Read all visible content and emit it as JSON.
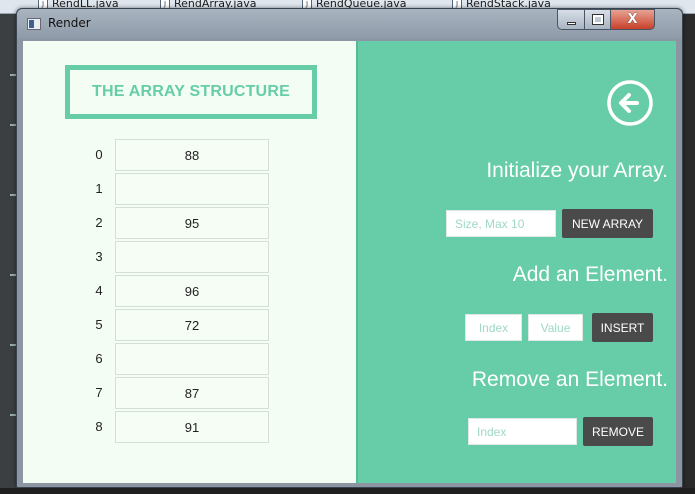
{
  "editor": {
    "tabs": [
      "RendLL.java",
      "RendArray.java",
      "RendQueue.java",
      "RendStack.java"
    ]
  },
  "window": {
    "title": "Render",
    "close_glyph": "X"
  },
  "array_panel": {
    "title": "THE ARRAY STRUCTURE",
    "rows": [
      {
        "index": "0",
        "value": "88"
      },
      {
        "index": "1",
        "value": ""
      },
      {
        "index": "2",
        "value": "95"
      },
      {
        "index": "3",
        "value": ""
      },
      {
        "index": "4",
        "value": "96"
      },
      {
        "index": "5",
        "value": "72"
      },
      {
        "index": "6",
        "value": ""
      },
      {
        "index": "7",
        "value": "87"
      },
      {
        "index": "8",
        "value": "91"
      }
    ]
  },
  "controls": {
    "back_icon": "back-arrow-circle-icon",
    "initialize_heading": "Initialize your Array.",
    "size_placeholder": "Size, Max 10",
    "new_array_label": "NEW ARRAY",
    "add_heading": "Add an Element.",
    "index_placeholder": "Index",
    "value_placeholder": "Value",
    "insert_label": "INSERT",
    "remove_heading": "Remove an Element.",
    "remove_index_placeholder": "Index",
    "remove_label": "REMOVE"
  },
  "colors": {
    "accent": "#66cda8",
    "button_dark": "#4a4a4a",
    "panel_light": "#f4fdf3"
  }
}
